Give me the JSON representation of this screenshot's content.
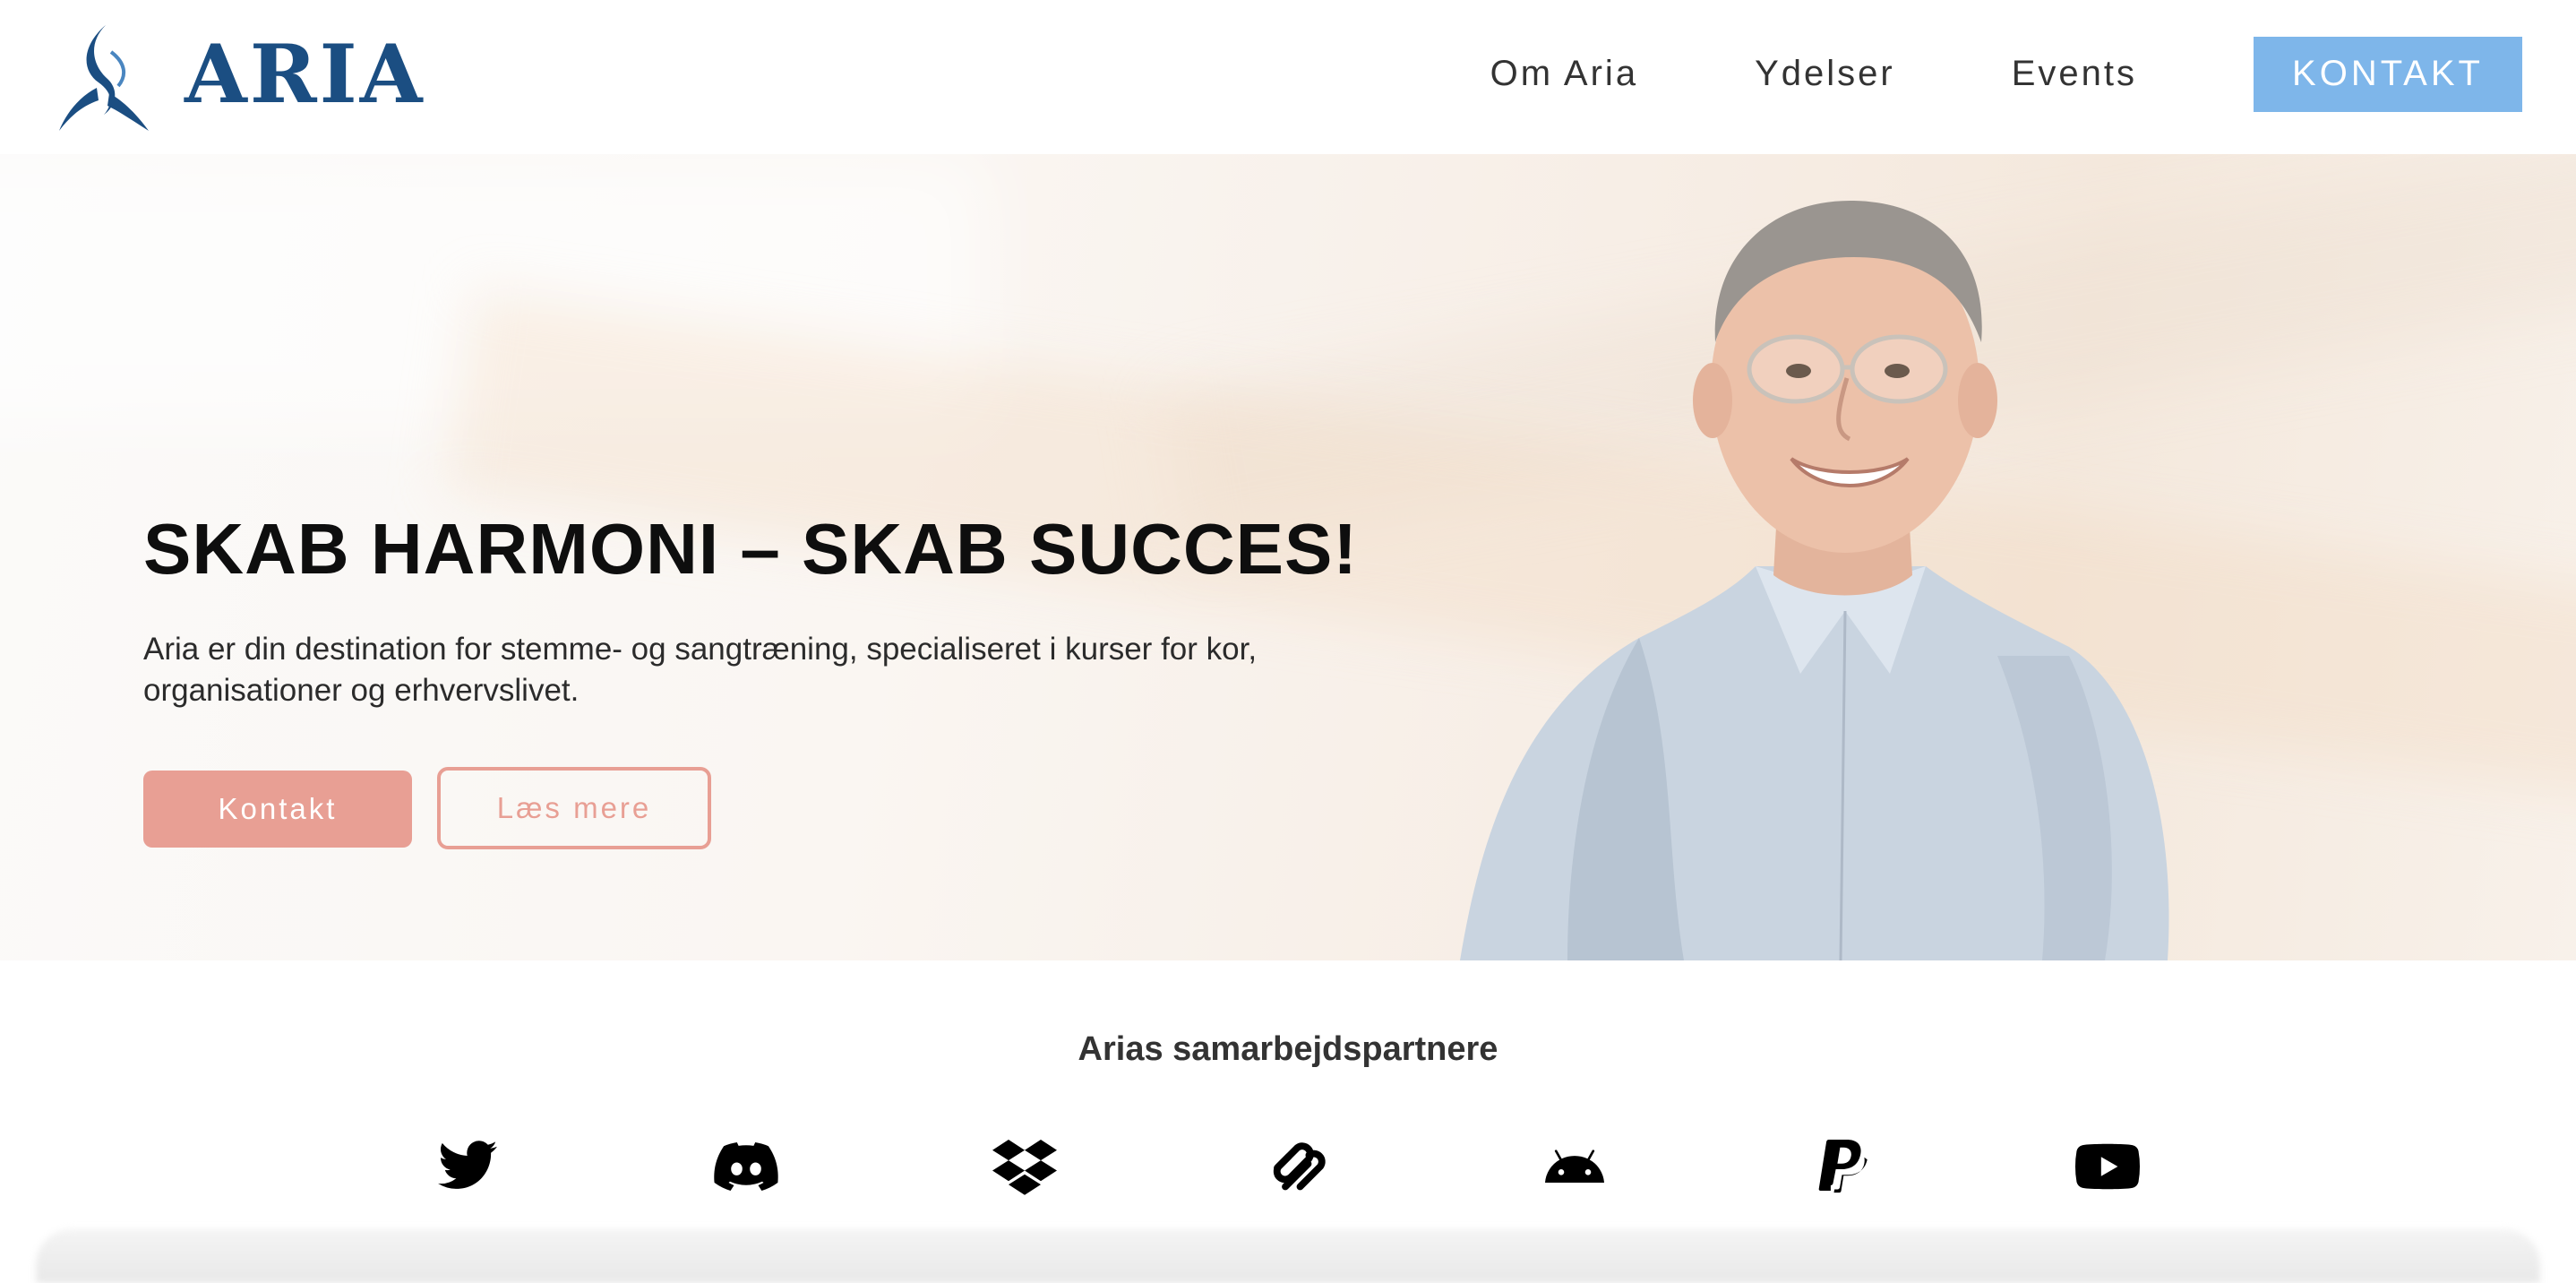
{
  "header": {
    "logo_text": "ARIA",
    "logo_color": "#1b4e82",
    "nav": [
      {
        "label": "Om Aria"
      },
      {
        "label": "Ydelser"
      },
      {
        "label": "Events"
      }
    ],
    "cta_label": "KONTAKT",
    "cta_color": "#7eb6ea"
  },
  "hero": {
    "title_regular": "SKAB HARMONI – SKAB ",
    "title_bold": "SUCCES!",
    "description": "Aria er din destination for stemme- og sangtræning, specialiseret i kurser for kor, organisationer og erhvervslivet.",
    "primary_button": "Kontakt",
    "secondary_button": "Læs mere",
    "accent_color": "#e89f94"
  },
  "partners": {
    "title": "Arias samarbejdspartnere",
    "icons": [
      "twitter-icon",
      "discord-icon",
      "dropbox-icon",
      "squarespace-icon",
      "android-icon",
      "paypal-icon",
      "youtube-icon"
    ]
  }
}
